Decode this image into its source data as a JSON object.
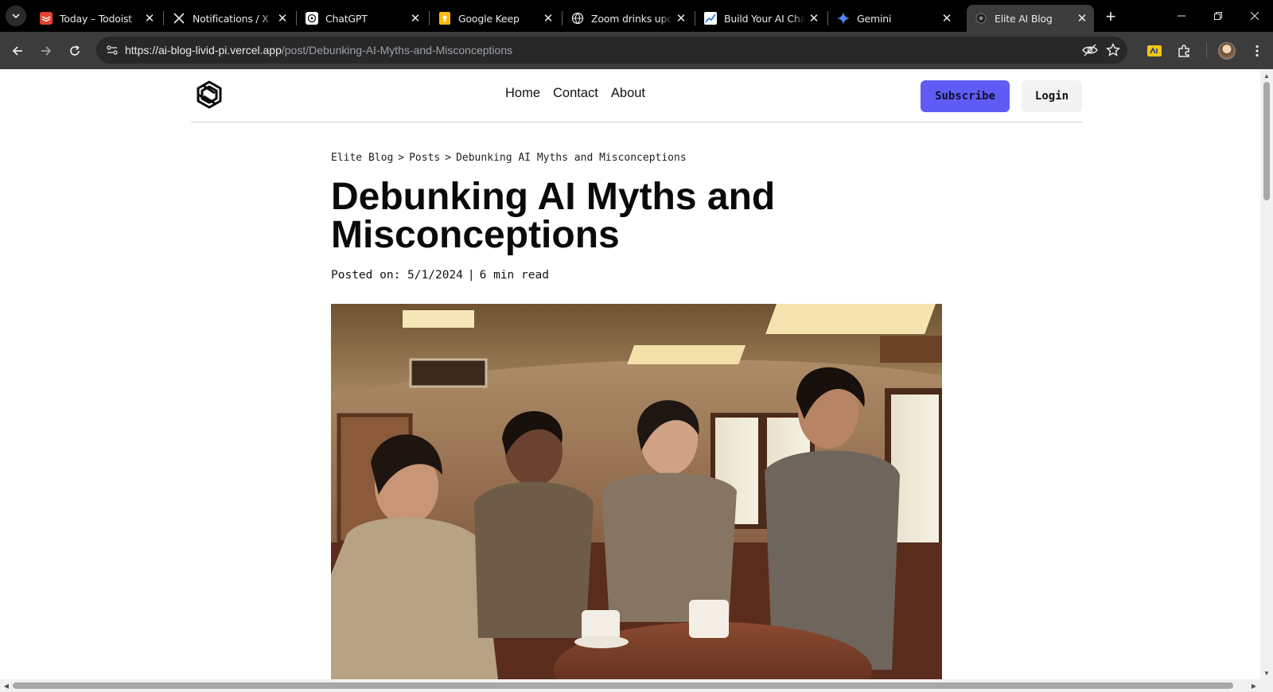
{
  "browser": {
    "tabs": [
      {
        "title": "Today – Todoist",
        "icon": "todoist-icon"
      },
      {
        "title": "Notifications / X",
        "icon": "x-logo-icon"
      },
      {
        "title": "ChatGPT",
        "icon": "chatgpt-icon"
      },
      {
        "title": "Google Keep",
        "icon": "google-keep-icon"
      },
      {
        "title": "Zoom drinks upon",
        "icon": "globe-icon"
      },
      {
        "title": "Build Your AI Chat",
        "icon": "chart-icon"
      },
      {
        "title": "Gemini",
        "icon": "gemini-sparkle-icon"
      },
      {
        "title": "Elite AI Blog",
        "icon": "site-favicon-icon"
      }
    ],
    "active_tab_index": 7,
    "url_host": "https://ai-blog-livid-pi.vercel.app",
    "url_path": "/post/Debunking-AI-Myths-and-Misconceptions"
  },
  "site": {
    "nav": [
      "Home",
      "Contact",
      "About"
    ],
    "subscribe_label": "Subscribe",
    "login_label": "Login",
    "accent_color": "#5f5cf5"
  },
  "post": {
    "breadcrumb": [
      "Elite Blog",
      "Posts",
      "Debunking AI Myths and Misconceptions"
    ],
    "breadcrumb_separator": ">",
    "title": "Debunking AI Myths and Misconceptions",
    "posted_label": "Posted on:",
    "date": "5/1/2024",
    "meta_separator": "|",
    "read_time": "6 min read",
    "hero_image": "hero-image"
  }
}
